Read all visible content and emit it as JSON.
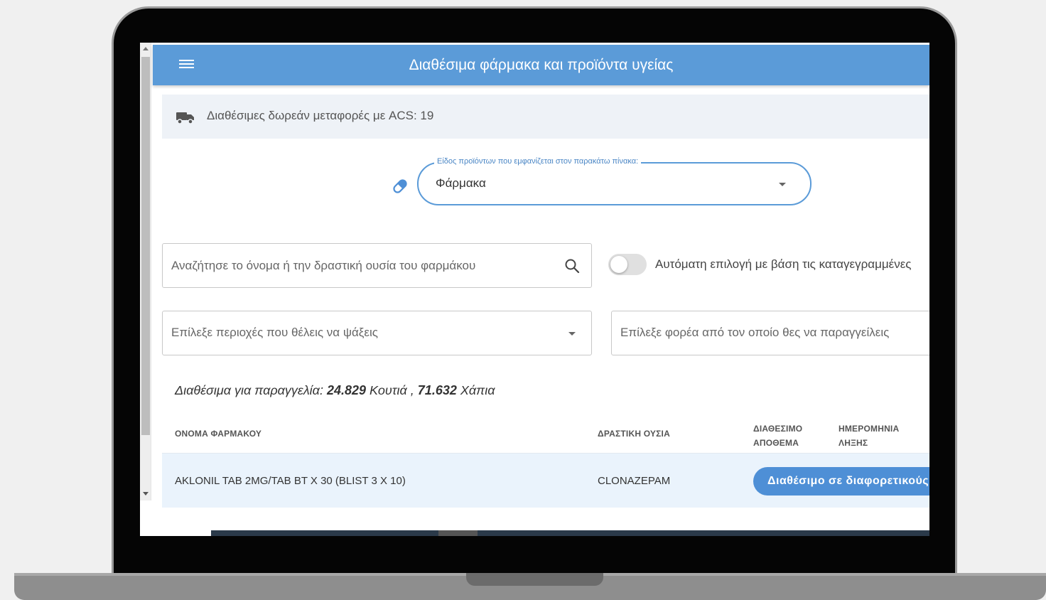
{
  "header": {
    "title": "Διαθέσιμα φάρμακα και προϊόντα υγείας"
  },
  "shipping_banner": {
    "text": "Διαθέσιμες δωρεάν μεταφορές με ACS: 19"
  },
  "product_type": {
    "legend": "Είδος προϊόντων που εμφανίζεται στον παρακάτω πίνακα:",
    "selected": "Φάρμακα"
  },
  "search": {
    "placeholder": "Αναζήτησε το όνομα ή την δραστική ουσία του φαρμάκου"
  },
  "auto_select": {
    "label": "Αυτόματη επιλογή με βάση τις καταγεγραμμένες",
    "enabled": false
  },
  "region_select": {
    "placeholder": "Επίλεξε περιοχές που θέλεις να ψάξεις"
  },
  "supplier_select": {
    "placeholder": "Επίλεξε φορέα από τον οποίο θες να παραγγείλεις"
  },
  "summary": {
    "prefix": "Διαθέσιμα για παραγγελία:",
    "boxes_count": "24.829",
    "boxes_label": "Κουτιά",
    "separator": ",",
    "pills_count": "71.632",
    "pills_label": "Χάπια"
  },
  "table": {
    "columns": {
      "name": "ΟΝΟΜΑ ΦΑΡΜΑΚΟΥ",
      "substance": "ΔΡΑΣΤΙΚΗ ΟΥΣΙΑ",
      "stock_line1": "ΔΙΑΘΕΣΙΜΟ",
      "stock_line2": "ΑΠΟΘΕΜΑ",
      "expiry_line1": "ΗΜΕΡΟΜΗΝΙΑ",
      "expiry_line2": "ΛΗΞΗΣ"
    },
    "rows": [
      {
        "name": "AKLONIL TAB 2MG/TAB BT X 30 (BLIST 3 X 10)",
        "substance": "CLONAZEPAM",
        "action": "Διαθέσιμο σε διαφορετικούς"
      }
    ]
  },
  "colors": {
    "appbar": "#5b9bd8",
    "accent": "#4e8fd6",
    "row_highlight": "#eaf3fc",
    "banner": "#eef2f7"
  },
  "icons": [
    "menu-icon",
    "truck-icon",
    "pill-icon",
    "search-icon",
    "chevron-down-icon"
  ]
}
